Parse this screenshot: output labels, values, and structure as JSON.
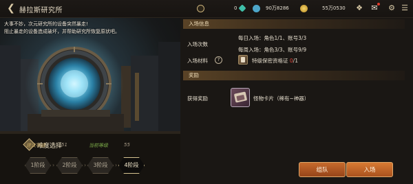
{
  "header": {
    "title": "赫拉斯研究所",
    "resources": [
      {
        "icon": "fatigue-icon",
        "value": "0",
        "color": "#c9b07a"
      },
      {
        "icon": "crystal-icon",
        "value": "90万8286",
        "color": "#3fbfa8"
      },
      {
        "icon": "gold-icon",
        "value": "55万0530",
        "color": "#e2b746"
      }
    ],
    "extra_values": [
      "0"
    ]
  },
  "scene": {
    "intro_line1": "大事不妙，次元研究所的设备突然暴走!",
    "intro_line2": "阻止暴走的设备造成破坏，并帮助研究所恢复原状吧。"
  },
  "difficulty": {
    "title": "难度选择",
    "recommend_label": "建议等级",
    "recommend_value": "51",
    "current_label": "当前等级",
    "current_value": "55",
    "stages": [
      "1阶段",
      "2阶段",
      "3阶段",
      "4阶段"
    ],
    "active_stage": 4
  },
  "entry": {
    "heading": "入场信息",
    "count_label": "入场次数",
    "daily": "每日入场：角色1/1、账号3/3",
    "weekly": "每周入场：角色3/3、账号9/9",
    "material_label": "入场材料",
    "material_name": "特级保密资格证",
    "material_have": "0",
    "material_need": "/1"
  },
  "reward": {
    "heading": "奖励",
    "label": "获得奖励",
    "item": "怪物卡片（稀有~神器）"
  },
  "buttons": {
    "team": "组队",
    "enter": "入场"
  }
}
